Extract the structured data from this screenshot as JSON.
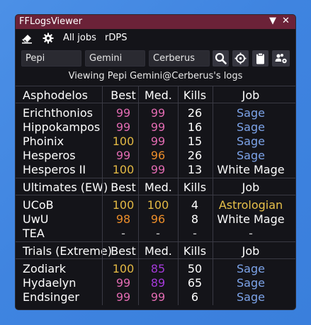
{
  "window": {
    "title": "FFLogsViewer",
    "collapse_glyph": "▼",
    "close_glyph": "✕"
  },
  "toolbar": {
    "eraser_icon": "eraser-icon",
    "settings_icon": "gear-icon",
    "all_jobs_label": "All jobs",
    "metric_label": "rDPS"
  },
  "search": {
    "first_name": "Pepi",
    "last_name": "Gemini",
    "world": "Cerberus",
    "buttons": [
      "search-icon",
      "crosshair-icon",
      "clipboard-icon",
      "party-icon"
    ]
  },
  "viewing_text": "Viewing Pepi Gemini@Cerberus's logs",
  "colors": {
    "pink": "#e06ab0",
    "orange": "#ea8c2a",
    "gold": "#e3b944",
    "purple": "#a43ad9",
    "grey": "#d0d0d0",
    "sage": "#7ca3e8",
    "astrologian": "#e8c14a",
    "white": "#ffffff"
  },
  "sections": [
    {
      "name": "Asphodelos",
      "headers": [
        "Best",
        "Med.",
        "Kills",
        "Job"
      ],
      "rows": [
        {
          "name": "Erichthonios",
          "best": "99",
          "best_color": "pink",
          "med": "99",
          "med_color": "pink",
          "kills": "26",
          "job": "Sage",
          "job_color": "sage"
        },
        {
          "name": "Hippokampos",
          "best": "99",
          "best_color": "pink",
          "med": "99",
          "med_color": "pink",
          "kills": "16",
          "job": "Sage",
          "job_color": "sage"
        },
        {
          "name": "Phoinix",
          "best": "100",
          "best_color": "gold",
          "med": "99",
          "med_color": "pink",
          "kills": "15",
          "job": "Sage",
          "job_color": "sage"
        },
        {
          "name": "Hesperos",
          "best": "99",
          "best_color": "pink",
          "med": "96",
          "med_color": "orange",
          "kills": "26",
          "job": "Sage",
          "job_color": "sage"
        },
        {
          "name": "Hesperos II",
          "best": "100",
          "best_color": "gold",
          "med": "99",
          "med_color": "pink",
          "kills": "13",
          "job": "White Mage",
          "job_color": "white"
        }
      ]
    },
    {
      "name": "Ultimates (EW)",
      "headers": [
        "Best",
        "Med.",
        "Kills",
        "Job"
      ],
      "rows": [
        {
          "name": "UCoB",
          "best": "100",
          "best_color": "gold",
          "med": "100",
          "med_color": "gold",
          "kills": "4",
          "job": "Astrologian",
          "job_color": "astrologian"
        },
        {
          "name": "UwU",
          "best": "98",
          "best_color": "orange",
          "med": "96",
          "med_color": "orange",
          "kills": "8",
          "job": "White Mage",
          "job_color": "white"
        },
        {
          "name": "TEA",
          "best": "-",
          "best_color": "grey",
          "med": "-",
          "med_color": "grey",
          "kills": "-",
          "job": "-",
          "job_color": "grey"
        }
      ]
    },
    {
      "name": "Trials (Extreme)",
      "headers": [
        "Best",
        "Med.",
        "Kills",
        "Job"
      ],
      "rows": [
        {
          "name": "Zodiark",
          "best": "100",
          "best_color": "gold",
          "med": "85",
          "med_color": "purple",
          "kills": "50",
          "job": "Sage",
          "job_color": "sage"
        },
        {
          "name": "Hydaelyn",
          "best": "99",
          "best_color": "pink",
          "med": "89",
          "med_color": "purple",
          "kills": "65",
          "job": "Sage",
          "job_color": "sage"
        },
        {
          "name": "Endsinger",
          "best": "99",
          "best_color": "pink",
          "med": "99",
          "med_color": "pink",
          "kills": "6",
          "job": "Sage",
          "job_color": "sage"
        }
      ]
    }
  ]
}
